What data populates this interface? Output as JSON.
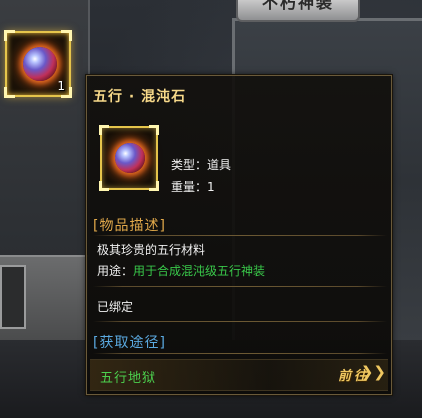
{
  "background": {
    "panel_title": "不朽神装"
  },
  "item_slot": {
    "icon": "chaos-orb-icon",
    "count": "1"
  },
  "tooltip": {
    "title": "五行 · 混沌石",
    "icon": "chaos-orb-icon",
    "attrs": {
      "type_label": "类型：",
      "type_value": "道具",
      "qty_label": "重量：",
      "qty_value": "1"
    },
    "desc_header": "[物品描述]",
    "desc_text": "极其珍贵的五行材料",
    "use_label": "用途：",
    "use_value": "用于合成混沌级五行神装",
    "bound_text": "已绑定",
    "source_header": "[获取途径]",
    "sources": [
      {
        "name": "五行地狱",
        "action": "前往",
        "icon": "double-chevron-right-icon"
      }
    ]
  },
  "colors": {
    "title": "#f7d98a",
    "desc_header": "#e0a84a",
    "source_header": "#5aa9e0",
    "use_value": "#39c84a",
    "source_name": "#4cd04e",
    "slot_border": "#e5c64c"
  }
}
